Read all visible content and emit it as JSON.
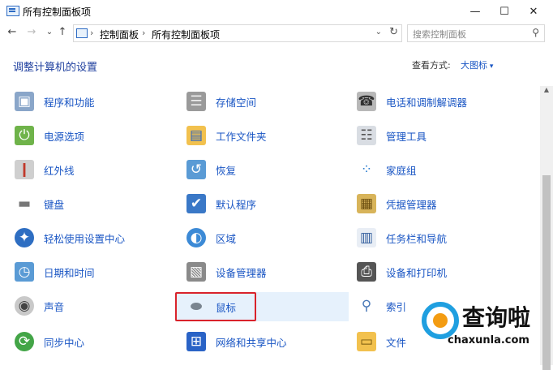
{
  "window": {
    "title": "所有控制面板项",
    "minimize": "—",
    "maximize": "☐",
    "close": "✕"
  },
  "nav": {
    "back": "←",
    "forward": "→",
    "recent": "⌄",
    "up": "↑"
  },
  "address": {
    "crumbs": [
      "控制面板",
      "所有控制面板项"
    ],
    "sep": "›",
    "dropdown": "⌄",
    "refresh": "↻"
  },
  "search": {
    "placeholder": "搜索控制面板",
    "icon": "⚲"
  },
  "heading": "调整计算机的设置",
  "view": {
    "label": "查看方式:",
    "value": "大图标"
  },
  "colors": {
    "link": "#1a56c4",
    "heading": "#1e3f9e",
    "highlight_box": "#d9232b"
  },
  "items": [
    {
      "label": "程序和功能",
      "icon": "programs-icon"
    },
    {
      "label": "存储空间",
      "icon": "storage-icon"
    },
    {
      "label": "电话和调制解调器",
      "icon": "phone-modem-icon"
    },
    {
      "label": "电源选项",
      "icon": "power-icon"
    },
    {
      "label": "工作文件夹",
      "icon": "work-folder-icon"
    },
    {
      "label": "管理工具",
      "icon": "admin-tools-icon"
    },
    {
      "label": "红外线",
      "icon": "infrared-icon"
    },
    {
      "label": "恢复",
      "icon": "recovery-icon"
    },
    {
      "label": "家庭组",
      "icon": "homegroup-icon"
    },
    {
      "label": "键盘",
      "icon": "keyboard-icon"
    },
    {
      "label": "默认程序",
      "icon": "default-programs-icon"
    },
    {
      "label": "凭据管理器",
      "icon": "credential-icon"
    },
    {
      "label": "轻松使用设置中心",
      "icon": "ease-of-access-icon"
    },
    {
      "label": "区域",
      "icon": "region-icon"
    },
    {
      "label": "任务栏和导航",
      "icon": "taskbar-icon"
    },
    {
      "label": "日期和时间",
      "icon": "datetime-icon"
    },
    {
      "label": "设备管理器",
      "icon": "device-manager-icon"
    },
    {
      "label": "设备和打印机",
      "icon": "printer-icon"
    },
    {
      "label": "声音",
      "icon": "sound-icon"
    },
    {
      "label": "鼠标",
      "icon": "mouse-icon"
    },
    {
      "label": "索引",
      "icon": "indexing-icon"
    },
    {
      "label": "同步中心",
      "icon": "sync-icon"
    },
    {
      "label": "网络和共享中心",
      "icon": "network-icon"
    },
    {
      "label": "文件",
      "icon": "file-icon"
    }
  ],
  "watermark": {
    "text": "查询啦",
    "url": "chaxunla.com"
  }
}
